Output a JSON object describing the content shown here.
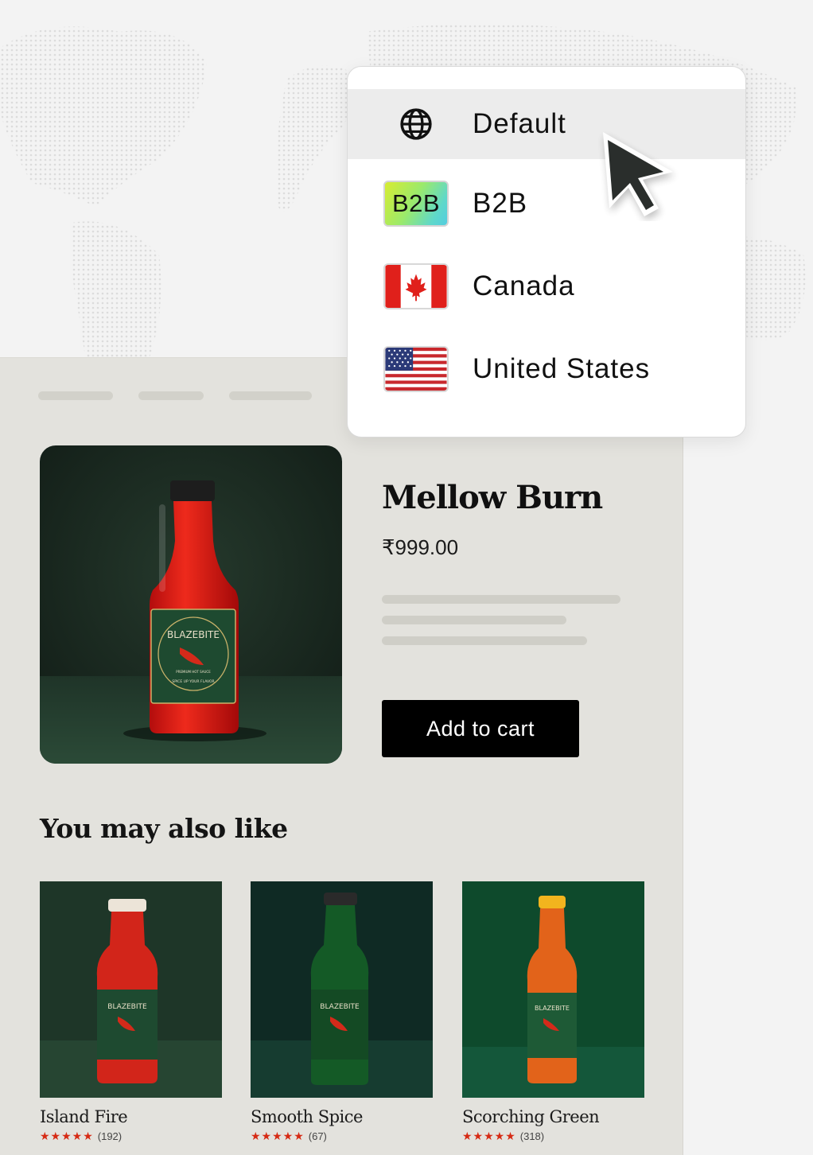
{
  "country_selector": {
    "items": [
      {
        "label": "Default",
        "icon": "globe-icon",
        "selected": true
      },
      {
        "label": "B2B",
        "icon": "b2b-badge",
        "badge_text": "B2B",
        "selected": false
      },
      {
        "label": "Canada",
        "icon": "canada-flag-icon",
        "selected": false
      },
      {
        "label": "United States",
        "icon": "us-flag-icon",
        "selected": false
      }
    ]
  },
  "product": {
    "title": "Mellow Burn",
    "price": "₹999.00",
    "add_to_cart_label": "Add to cart",
    "image_brand": "BLAZEBITE",
    "image_tagline": "SPICE UP YOUR FLAVOR",
    "image_subtag": "PREMIUM HOT SAUCE"
  },
  "recommendations": {
    "title": "You may also like",
    "items": [
      {
        "name": "Island Fire",
        "stars": "★★★★★",
        "reviews": "(192)"
      },
      {
        "name": "Smooth Spice",
        "stars": "★★★★★",
        "reviews": "(67)"
      },
      {
        "name": "Scorching Green",
        "stars": "★★★★★",
        "reviews": "(318)"
      }
    ]
  },
  "colors": {
    "panel": "#e3e2dd",
    "button": "#000000",
    "star": "#d62a14",
    "selected_row": "#ececec"
  }
}
